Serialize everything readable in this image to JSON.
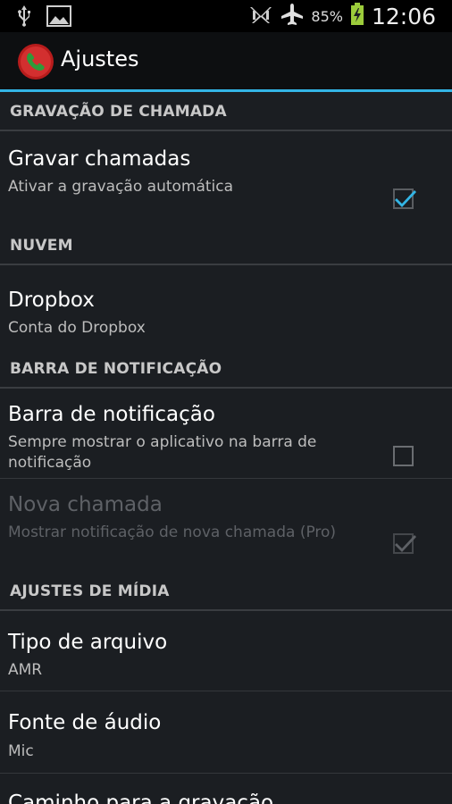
{
  "status_bar": {
    "left_icons": [
      "usb-icon",
      "image-icon"
    ],
    "right_icons": [
      "no-signal-icon",
      "airplane-mode-icon",
      "battery-charging-icon"
    ],
    "battery_percent": "85%",
    "time": "12:06"
  },
  "action_bar": {
    "title": "Ajustes",
    "icon": "call-recorder-app-icon"
  },
  "sections": {
    "call_recording": {
      "header": "GRAVAÇÃO DE CHAMADA",
      "record_calls": {
        "title": "Gravar chamadas",
        "summary": "Ativar a gravação automática",
        "checked": true
      }
    },
    "cloud": {
      "header": "NUVEM",
      "dropbox": {
        "title": "Dropbox",
        "summary": "Conta do Dropbox"
      }
    },
    "notification_bar": {
      "header": "BARRA DE NOTIFICAÇÃO",
      "notification_bar_pref": {
        "title": "Barra de notificação",
        "summary": "Sempre mostrar o aplicativo na barra de notificação",
        "checked": false
      },
      "new_call": {
        "title": "Nova chamada",
        "summary": "Mostrar notificação de nova chamada (Pro)",
        "checked": true,
        "enabled": false
      }
    },
    "media_settings": {
      "header": "AJUSTES DE MÍDIA",
      "file_type": {
        "title": "Tipo de arquivo",
        "summary": "AMR"
      },
      "audio_source": {
        "title": "Fonte de áudio",
        "summary": "Mic"
      },
      "recording_path": {
        "title": "Caminho para a gravação"
      }
    }
  },
  "colors": {
    "accent": "#33b5e5",
    "background": "#1b1e22",
    "header_text": "#c8c8c8",
    "disabled_text": "#5e6166",
    "app_icon_red": "#d32f2f",
    "app_icon_green": "#2e9b3a"
  }
}
